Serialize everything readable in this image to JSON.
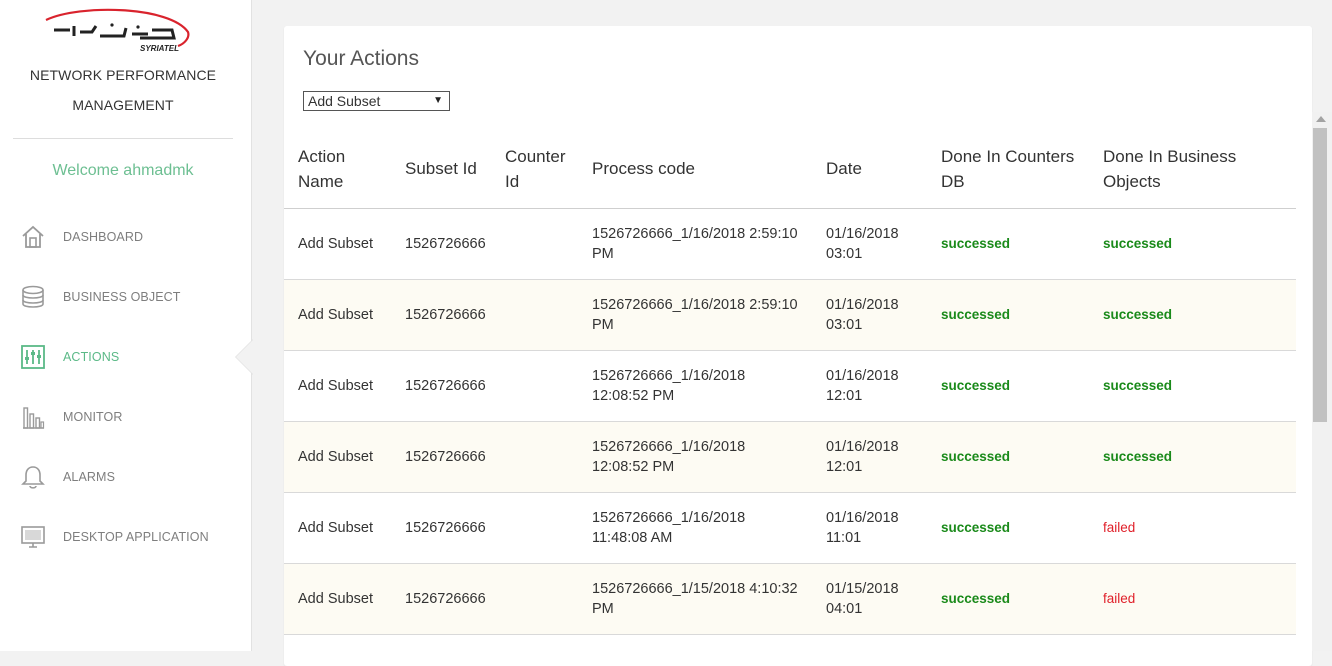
{
  "brand": {
    "logo_text": "SYRIATEL",
    "title_line1": "NETWORK PERFORMANCE",
    "title_line2": "MANAGEMENT",
    "accent": "#5bb987",
    "logo_color": "#d9232d"
  },
  "welcome": "Welcome ahmadmk",
  "nav": [
    {
      "label": "DASHBOARD",
      "icon": "home-icon",
      "active": false
    },
    {
      "label": "BUSINESS OBJECT",
      "icon": "database-icon",
      "active": false
    },
    {
      "label": "ACTIONS",
      "icon": "sliders-icon",
      "active": true
    },
    {
      "label": "MONITOR",
      "icon": "bar-chart-icon",
      "active": false
    },
    {
      "label": "ALARMS",
      "icon": "bell-icon",
      "active": false
    },
    {
      "label": "DESKTOP APPLICATION",
      "icon": "monitor-icon",
      "active": false
    }
  ],
  "panel": {
    "title": "Your Actions",
    "filter_selected": "Add Subset"
  },
  "table": {
    "headers": {
      "action_name": "Action Name",
      "subset_id": "Subset Id",
      "counter_id": "Counter Id",
      "process_code": "Process code",
      "date": "Date",
      "done_counters": "Done In Counters DB",
      "done_bo": "Done In Business Objects"
    },
    "rows": [
      {
        "action_name": "Add Subset",
        "subset_id": "1526726666",
        "counter_id": "",
        "process_code_1": "1526726666_1/16/2018 2:59:10",
        "process_code_2": "PM",
        "date_1": "01/16/2018",
        "date_2": "03:01",
        "done_counters": "successed",
        "done_bo": "successed"
      },
      {
        "action_name": "Add Subset",
        "subset_id": "1526726666",
        "counter_id": "",
        "process_code_1": "1526726666_1/16/2018 2:59:10",
        "process_code_2": "PM",
        "date_1": "01/16/2018",
        "date_2": "03:01",
        "done_counters": "successed",
        "done_bo": "successed"
      },
      {
        "action_name": "Add Subset",
        "subset_id": "1526726666",
        "counter_id": "",
        "process_code_1": "1526726666_1/16/2018",
        "process_code_2": "12:08:52 PM",
        "date_1": "01/16/2018",
        "date_2": "12:01",
        "done_counters": "successed",
        "done_bo": "successed"
      },
      {
        "action_name": "Add Subset",
        "subset_id": "1526726666",
        "counter_id": "",
        "process_code_1": "1526726666_1/16/2018",
        "process_code_2": "12:08:52 PM",
        "date_1": "01/16/2018",
        "date_2": "12:01",
        "done_counters": "successed",
        "done_bo": "successed"
      },
      {
        "action_name": "Add Subset",
        "subset_id": "1526726666",
        "counter_id": "",
        "process_code_1": "1526726666_1/16/2018",
        "process_code_2": "11:48:08 AM",
        "date_1": "01/16/2018",
        "date_2": "11:01",
        "done_counters": "successed",
        "done_bo": "failed"
      },
      {
        "action_name": "Add Subset",
        "subset_id": "1526726666",
        "counter_id": "",
        "process_code_1": "1526726666_1/15/2018 4:10:32",
        "process_code_2": "PM",
        "date_1": "01/15/2018",
        "date_2": "04:01",
        "done_counters": "successed",
        "done_bo": "failed"
      }
    ]
  }
}
